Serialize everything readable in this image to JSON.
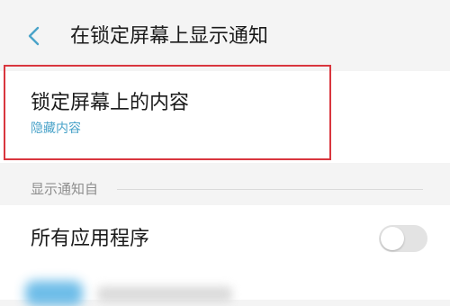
{
  "header": {
    "title": "在锁定屏幕上显示通知",
    "back_icon": "chevron-left-icon"
  },
  "lock_content": {
    "title": "锁定屏幕上的内容",
    "value": "隐藏内容"
  },
  "section": {
    "label": "显示通知自"
  },
  "all_apps": {
    "label": "所有应用程序",
    "toggle_on": false
  },
  "colors": {
    "accent": "#4aa3c9",
    "highlight_border": "#d9363e"
  }
}
